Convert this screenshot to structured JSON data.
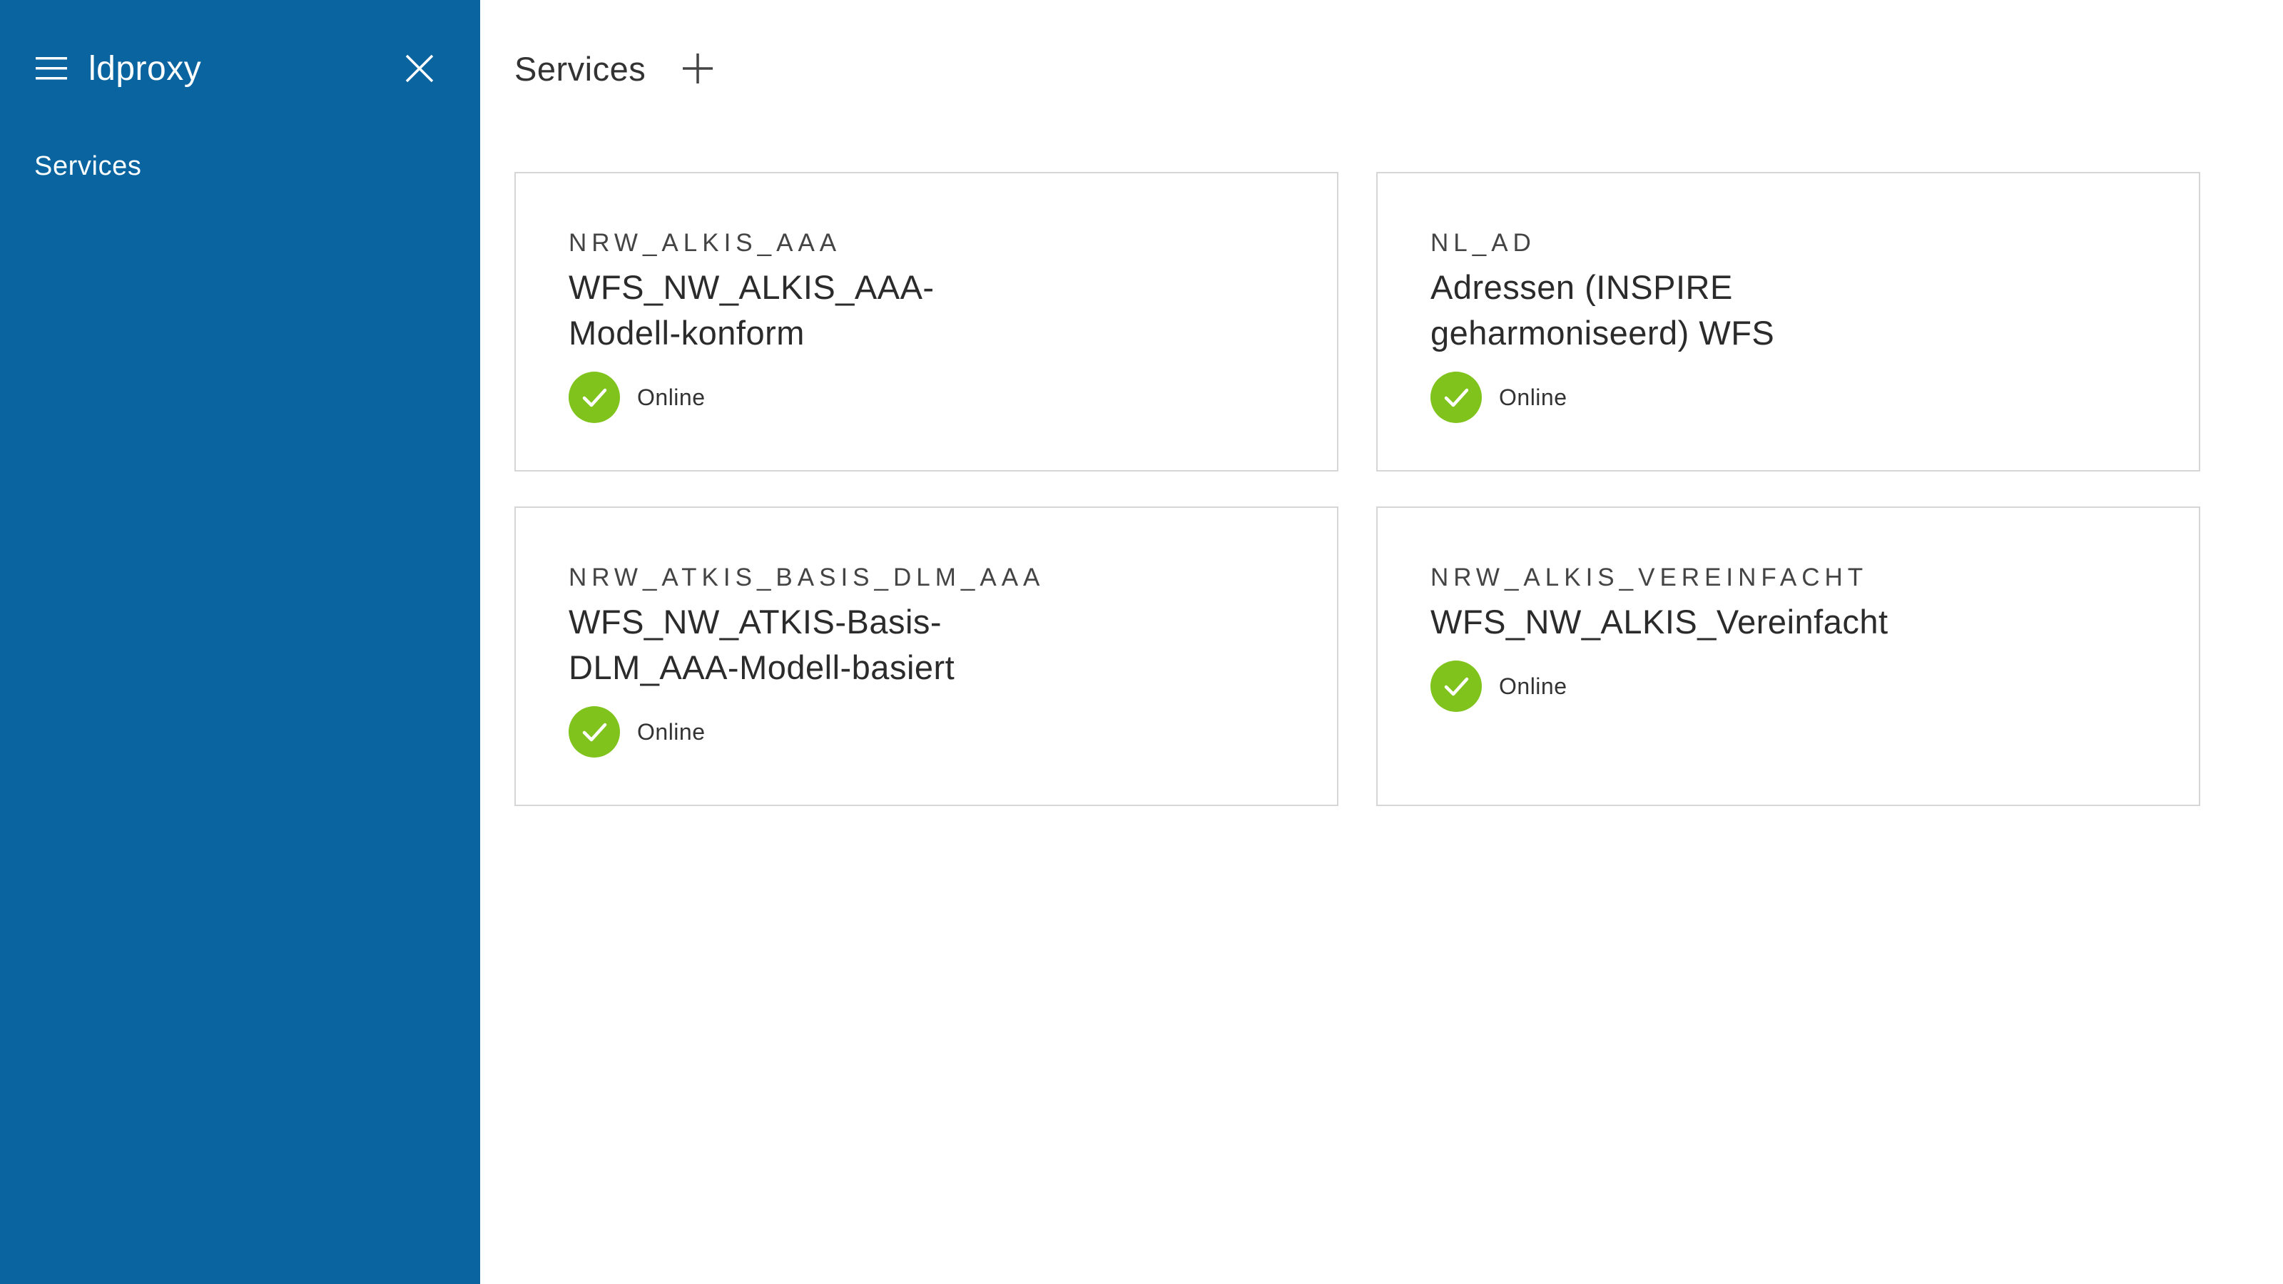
{
  "sidebar": {
    "brand": "ldproxy",
    "menu_icon": "hamburger-menu-icon",
    "close_icon": "close-icon",
    "nav_items": [
      {
        "label": "Services"
      }
    ],
    "background_color": "#0a64a0"
  },
  "header": {
    "title": "Services",
    "add_icon": "plus-icon"
  },
  "services": [
    {
      "id": "NRW_ALKIS_AAA",
      "label": "WFS_NW_ALKIS_AAA-Modell-konform",
      "status": "Online"
    },
    {
      "id": "NL_AD",
      "label": "Adressen (INSPIRE geharmoniseerd) WFS",
      "status": "Online"
    },
    {
      "id": "NRW_ATKIS_BASIS_DLM_AAA",
      "label": "WFS_NW_ATKIS-Basis-DLM_AAA-Modell-basiert",
      "status": "Online"
    },
    {
      "id": "NRW_ALKIS_VEREINFACHT",
      "label": "WFS_NW_ALKIS_Vereinfacht",
      "status": "Online"
    }
  ],
  "status_color_online": "#7fc31c"
}
